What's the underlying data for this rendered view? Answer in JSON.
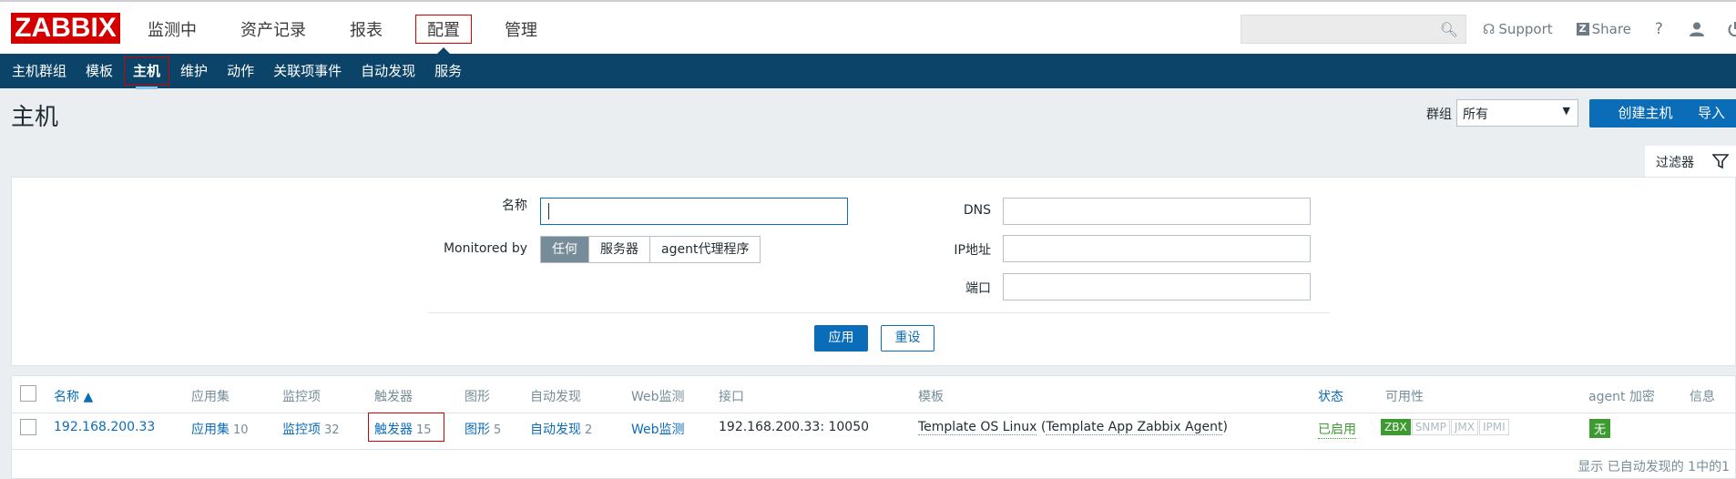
{
  "header": {
    "logo": "ZABBIX",
    "nav": [
      "监测中",
      "资产记录",
      "报表",
      "配置",
      "管理"
    ],
    "active_nav": "配置",
    "support": "Support",
    "share": "Share",
    "help": "?"
  },
  "subnav": [
    "主机群组",
    "模板",
    "主机",
    "维护",
    "动作",
    "关联项事件",
    "自动发现",
    "服务"
  ],
  "page": {
    "title": "主机",
    "group_label": "群组",
    "group_value": "所有",
    "create_button": "创建主机",
    "import_button": "导入"
  },
  "filter": {
    "tab_label": "过滤器",
    "name_label": "名称",
    "name_value": "",
    "monitored_label": "Monitored by",
    "monitored_options": [
      "任何",
      "服务器",
      "agent代理程序"
    ],
    "monitored_selected": "任何",
    "dns_label": "DNS",
    "ip_label": "IP地址",
    "port_label": "端口",
    "apply": "应用",
    "reset": "重设"
  },
  "table": {
    "columns": [
      "名称 ▲",
      "应用集",
      "监控项",
      "触发器",
      "图形",
      "自动发现",
      "Web监测",
      "接口",
      "模板",
      "状态",
      "可用性",
      "agent 加密",
      "信息"
    ],
    "row": {
      "name": "192.168.200.33",
      "apps": "应用集",
      "apps_count": "10",
      "items": "监控项",
      "items_count": "32",
      "triggers": "触发器",
      "triggers_count": "15",
      "graphs": "图形",
      "graphs_count": "5",
      "discovery": "自动发现",
      "discovery_count": "2",
      "web": "Web监测",
      "interface": "192.168.200.33: 10050",
      "template_main": "Template OS Linux",
      "template_paren_open": " (",
      "template_sub": "Template App Zabbix Agent",
      "template_paren_close": ")",
      "status": "已启用",
      "availability": [
        "ZBX",
        "SNMP",
        "JMX",
        "IPMI"
      ],
      "encryption": "无"
    },
    "footer": "显示 已自动发现的 1中的1"
  },
  "colors": {
    "brand_red": "#d40000",
    "nav_blue": "#0b4468",
    "link_blue": "#0b6cb7",
    "green": "#3d9b31"
  }
}
